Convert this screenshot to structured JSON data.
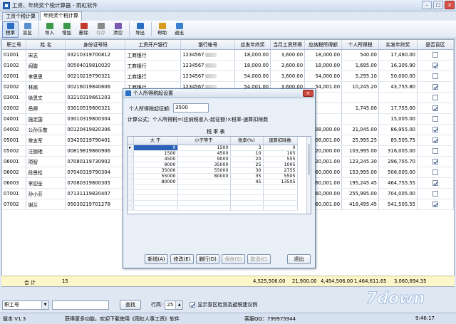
{
  "window": {
    "title": "工资、年终奖个税计算器 - 雨虹软件"
  },
  "tabs": [
    "工资个税计算",
    "年终奖个税计算"
  ],
  "toolbar": [
    {
      "label": "税率",
      "icon": "tax-rate-icon",
      "active": true
    },
    {
      "label": "盲区",
      "icon": "blind-zone-icon"
    },
    {
      "label": "导入",
      "icon": "import-icon"
    },
    {
      "label": "增加",
      "icon": "add-icon"
    },
    {
      "label": "删除",
      "icon": "delete-icon"
    },
    {
      "label": "保存",
      "icon": "save-icon",
      "disabled": true
    },
    {
      "label": "清空",
      "icon": "clear-icon"
    },
    {
      "label": "导出",
      "icon": "export-icon"
    },
    {
      "label": "帮助",
      "icon": "help-icon"
    },
    {
      "label": "退出",
      "icon": "exit-icon"
    }
  ],
  "grid": {
    "columns": [
      "职工号",
      "姓 名",
      "身份证号码",
      "工资开户银行",
      "银行帐号",
      "应发年终奖",
      "当月工资所得",
      "应纳税所得额",
      "个人所得税",
      "实发年终奖",
      "是否盲区"
    ],
    "rows": [
      [
        "01001",
        "宋志",
        "03210319700812",
        "工商银行",
        "1234567",
        "18,000.00",
        "3,600.00",
        "18,000.00",
        "540.00",
        "17,460.00",
        false
      ],
      [
        "01002",
        "阎璇",
        "00504019810020",
        "工商银行",
        "1234567",
        "18,000.00",
        "3,600.00",
        "18,000.00",
        "1,695.00",
        "16,305.90",
        true
      ],
      [
        "02001",
        "李思思",
        "00210219790321",
        "工商银行",
        "1234567",
        "54,000.00",
        "3,600.00",
        "54,000.00",
        "5,295.10",
        "50,000.00",
        false
      ],
      [
        "02002",
        "林嫣",
        "00216019840606",
        "工商银行",
        "1234567",
        "54,001.00",
        "3,600.00",
        "54,001.00",
        "10,245.20",
        "43,755.80",
        true
      ],
      [
        "03001",
        "徐恩文",
        "03210319661203",
        "工商银行",
        "1234567",
        "",
        "",
        "",
        "",
        "",
        false
      ],
      [
        "03002",
        "岳卿",
        "03010519800321",
        "",
        "",
        "",
        "",
        "",
        "1,745.00",
        "17,755.00",
        true
      ],
      [
        "04001",
        "施定国",
        "03010319800304",
        "",
        "",
        "",
        "",
        "",
        "",
        "15,005.00",
        false
      ],
      [
        "04002",
        "公孙乐敬",
        "00120419820306",
        "",
        "",
        "",
        "",
        "108,000.00",
        "21,045.00",
        "86,955.00",
        true
      ],
      [
        "05001",
        "常志军",
        "03420219790401",
        "",
        "",
        "",
        "",
        "108,001.00",
        "25,995.25",
        "85,505.75",
        true
      ],
      [
        "05002",
        "汪丽艳",
        "00819819860906",
        "",
        "",
        "",
        "",
        "420,000.00",
        "103,995.00",
        "316,005.00",
        false
      ],
      [
        "06001",
        "项智",
        "07080119730902",
        "",
        "",
        "",
        "",
        "420,001.00",
        "123,245.30",
        "296,755.70",
        true
      ],
      [
        "06002",
        "段景松",
        "07040319790304",
        "",
        "",
        "",
        "",
        "660,000.00",
        "153,995.00",
        "506,005.00",
        false
      ],
      [
        "06003",
        "李迎全",
        "07080319800305",
        "",
        "",
        "",
        "",
        "660,001.00",
        "195,245.45",
        "464,755.55",
        true
      ],
      [
        "07001",
        "孙小芬",
        "07131119820407",
        "",
        "",
        "",
        "",
        "960,000.00",
        "255,995.00",
        "704,005.00",
        false
      ],
      [
        "07002",
        "谢兰",
        "05030219701278",
        "",
        "",
        "",
        "",
        "960,001.00",
        "418,495.45",
        "541,505.55",
        true
      ]
    ],
    "total": {
      "label": "合 计",
      "count": "15",
      "bonus": "4,525,506.00",
      "salary": "21,900.00",
      "taxable": "4,494,506.00",
      "tax": "1,464,611.65",
      "net": "3,060,894.35"
    }
  },
  "bottom": {
    "field_select": "职工号",
    "search_button": "查找",
    "rows_label": "行高:",
    "rows_value": "25",
    "checkbox_label": "显示盲区检测及避税建议例"
  },
  "status": {
    "version": "版本 V1.3",
    "message": "获得更多功能，欢迎下载使用《雨虹人事工资》软件",
    "qq": "客服QQ：799975944",
    "time": "9:46:17"
  },
  "dialog": {
    "title": "个人所得税起设置",
    "threshold_label": "个人所得税起征额:",
    "threshold_value": "3500",
    "formula": "计算公式：个人所得税=(应纳税收入-起征额)×税率-速算扣除数",
    "table_title": "税 率 表",
    "columns": [
      "大 于",
      "小于等于",
      "税率(%)",
      "速算扣除数"
    ],
    "rows": [
      [
        "0",
        "1500",
        "3",
        "0"
      ],
      [
        "1500",
        "4500",
        "10",
        "105"
      ],
      [
        "4500",
        "9000",
        "20",
        "555"
      ],
      [
        "9000",
        "35000",
        "25",
        "1005"
      ],
      [
        "35000",
        "55000",
        "30",
        "2755"
      ],
      [
        "55000",
        "80000",
        "35",
        "5505"
      ],
      [
        "80000",
        "",
        "45",
        "13505"
      ]
    ],
    "buttons": [
      "新增(A)",
      "修改(E)",
      "删行(D)",
      "保存(S)",
      "取消(C)",
      "退出"
    ]
  },
  "watermark": "7down"
}
